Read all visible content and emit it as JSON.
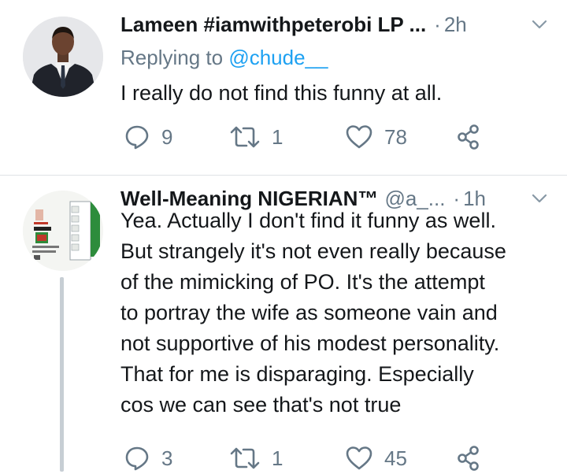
{
  "tweets": [
    {
      "name": "Lameen #iamwithpeterobi LP ...",
      "handle": "",
      "dot": "·",
      "time": "2h",
      "reply_prefix": "Replying to ",
      "reply_to": "@chude__",
      "text": "I really do not find this funny at all.",
      "avatar_icon": "profile-photo-man-in-suit",
      "counts": {
        "replies": "9",
        "retweets": "1",
        "likes": "78"
      }
    },
    {
      "name": "Well-Meaning NIGERIAN™",
      "handle": "@a_...",
      "dot": "·",
      "time": "1h",
      "text": "Yea. Actually I don't find it funny as well.\nBut strangely it's not even really because\nof the mimicking of PO. It's the attempt\nto portray the wife as someone vain and\nnot supportive of his modest personality.\nThat for me is disparaging. Especially\ncos we can see that's not true",
      "avatar_icon": "ballot-paper-image",
      "counts": {
        "replies": "3",
        "retweets": "1",
        "likes": "45"
      }
    }
  ],
  "colors": {
    "text": "#14171a",
    "secondary": "#657786",
    "link": "#1da1f2",
    "thread_line": "#c7ced4",
    "divider": "#dfe3e6"
  }
}
